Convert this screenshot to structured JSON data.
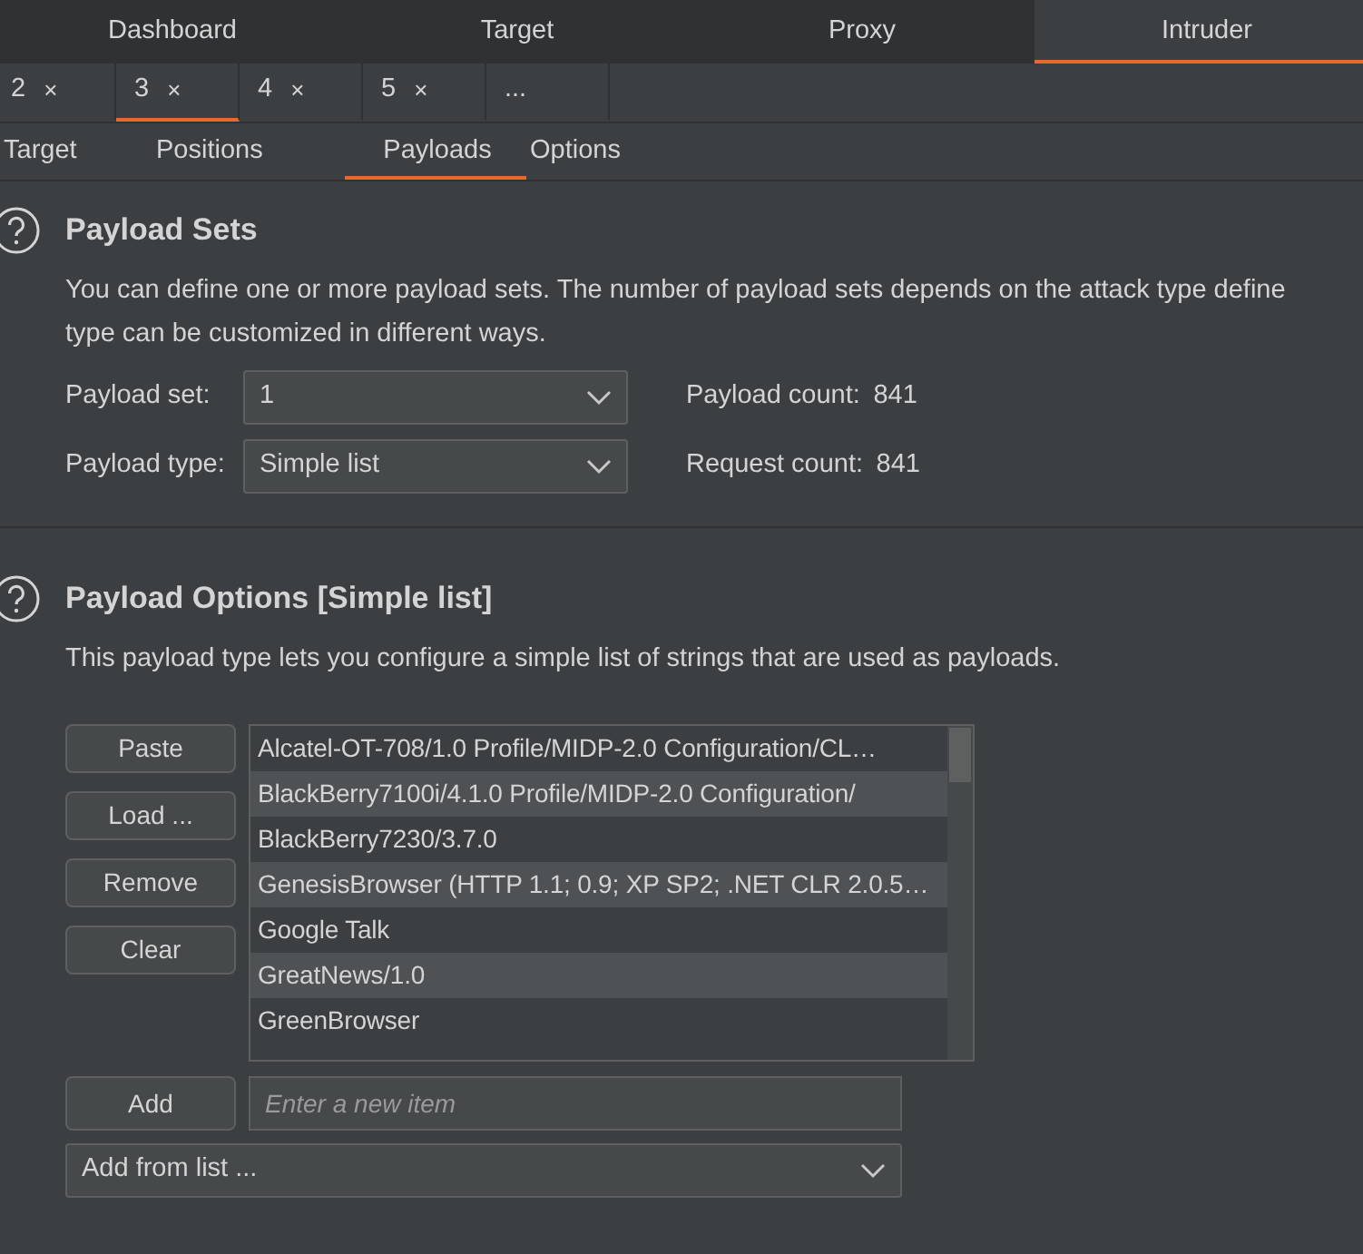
{
  "main_tabs": [
    {
      "label": "Dashboard",
      "selected": false
    },
    {
      "label": "Target",
      "selected": false
    },
    {
      "label": "Proxy",
      "selected": false
    },
    {
      "label": "Intruder",
      "selected": true
    }
  ],
  "attack_tabs": [
    {
      "label": "2",
      "close": "×",
      "selected": false
    },
    {
      "label": "3",
      "close": "×",
      "selected": true
    },
    {
      "label": "4",
      "close": "×",
      "selected": false
    },
    {
      "label": "5",
      "close": "×",
      "selected": false
    },
    {
      "label": "...",
      "selected": false
    }
  ],
  "sub_tabs": [
    {
      "label": "Target",
      "selected": false
    },
    {
      "label": "Positions",
      "selected": false
    },
    {
      "label": "Payloads",
      "selected": true
    },
    {
      "label": "Options",
      "selected": false
    }
  ],
  "payload_sets": {
    "title": "Payload Sets",
    "description_lines": [
      "You can define one or more payload sets. The number of payload sets depends on the attack type define",
      "type can be customized in different ways."
    ],
    "fields": [
      {
        "label": "Payload set:",
        "value": "1",
        "info_label": "Payload count:",
        "info_value": "841"
      },
      {
        "label": "Payload type:",
        "value": "Simple list",
        "info_label": "Request count:",
        "info_value": "841"
      }
    ]
  },
  "payload_options": {
    "title": "Payload Options [Simple list]",
    "description": "This payload type lets you configure a simple list of strings that are used as payloads.",
    "buttons": [
      "Paste",
      "Load ...",
      "Remove",
      "Clear"
    ],
    "items": [
      "Alcatel-OT-708/1.0 Profile/MIDP-2.0 Configuration/CL…",
      "BlackBerry7100i/4.1.0 Profile/MIDP-2.0 Configuration/",
      "BlackBerry7230/3.7.0",
      "GenesisBrowser (HTTP 1.1; 0.9; XP SP2; .NET CLR 2.0.5…",
      "Google Talk",
      "GreatNews/1.0",
      "GreenBrowser"
    ],
    "add_button": "Add",
    "new_item": {
      "placeholder": "Enter a new item"
    },
    "add_from_list": "Add from list ..."
  }
}
